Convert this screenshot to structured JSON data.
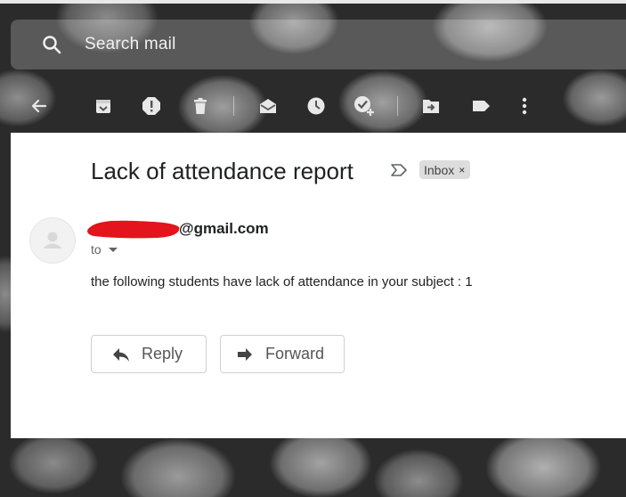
{
  "search": {
    "placeholder": "Search mail"
  },
  "toolbar": {
    "icons": [
      "back-arrow-icon",
      "archive-icon",
      "report-spam-icon",
      "delete-icon",
      "mark-unread-icon",
      "snooze-icon",
      "add-to-tasks-icon",
      "move-to-icon",
      "labels-icon",
      "more-options-icon"
    ]
  },
  "email": {
    "subject": "Lack of attendance report",
    "label": "Inbox",
    "label_remove": "×",
    "sender_domain": "@gmail.com",
    "to_label": "to",
    "body": "the following students have lack of attendance in your subject : 1"
  },
  "actions": {
    "reply_label": "Reply",
    "forward_label": "Forward"
  },
  "colors": {
    "redaction": "#e3141b",
    "text_primary": "#202124",
    "chip_bg": "#dddddd"
  }
}
